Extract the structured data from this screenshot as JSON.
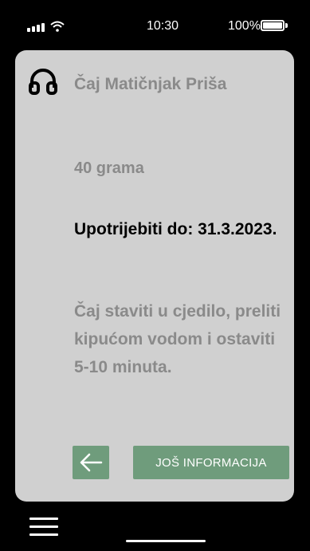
{
  "status_bar": {
    "time": "10:30",
    "battery_percent": "100%",
    "icons": [
      "signal-icon",
      "wifi-icon",
      "battery-icon"
    ]
  },
  "product": {
    "icon": "headphones-icon",
    "name": "Čaj Matičnjak Priša",
    "weight": "40 grama",
    "expiry": "Upotrijebiti do: 31.3.2023.",
    "instructions": "Čaj staviti u cjedilo, preliti kipućom vodom i ostaviti 5-10 minuta."
  },
  "actions": {
    "back_icon": "arrow-left-icon",
    "more_info_label": "JOŠ INFORMACIJA"
  },
  "bottom_bar": {
    "menu_icon": "hamburger-menu-icon"
  },
  "colors": {
    "background": "#000000",
    "card": "#d0d0d0",
    "muted_text": "#8a8a8a",
    "accent": "#6f9c7c"
  }
}
